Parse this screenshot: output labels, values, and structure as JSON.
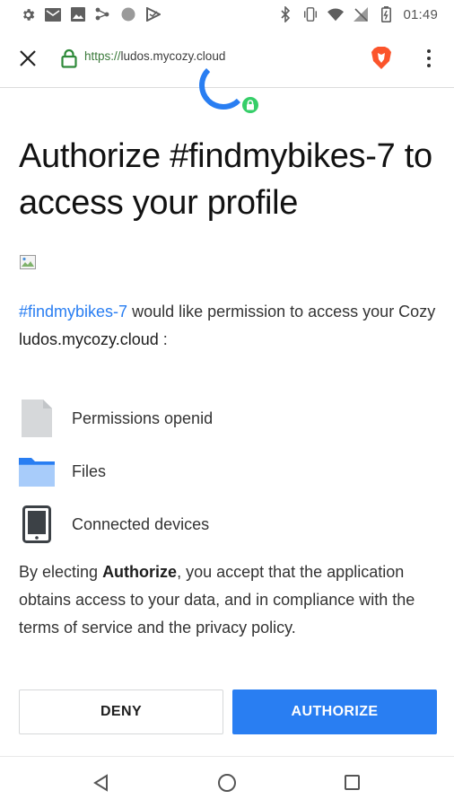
{
  "status_bar": {
    "time": "01:49",
    "left_icons": [
      "gear-icon",
      "mail-icon",
      "image-icon",
      "share-icon",
      "circle-icon",
      "play-protect-icon"
    ],
    "right_icons": [
      "bluetooth-icon",
      "vibrate-icon",
      "wifi-icon",
      "no-signal-icon",
      "battery-icon"
    ]
  },
  "browser": {
    "url_scheme": "https://",
    "url_host": "ludos.mycozy.cloud",
    "brand_color": "#fb542b"
  },
  "page": {
    "title": "Authorize #findmybikes-7 to access your profile",
    "intro_app": "#findmybikes-7",
    "intro_text": " would like permission to access your Cozy",
    "intro_domain": "ludos.mycozy.cloud",
    "intro_colon": " :",
    "permissions": [
      {
        "icon": "file-icon",
        "label": "Permissions openid"
      },
      {
        "icon": "folder-icon",
        "label": "Files"
      },
      {
        "icon": "tablet-icon",
        "label": "Connected devices"
      }
    ],
    "notice_prefix": "By electing ",
    "notice_bold": "Authorize",
    "notice_suffix": ", you accept that the application obtains access to your data, and in compliance with the terms of service and the privacy policy.",
    "deny_label": "DENY",
    "authorize_label": "AUTHORIZE",
    "accent_color": "#297ef2",
    "lock_badge_color": "#35ce68"
  },
  "nav_bar": {
    "icons": [
      "back-icon",
      "home-icon",
      "recents-icon"
    ]
  }
}
